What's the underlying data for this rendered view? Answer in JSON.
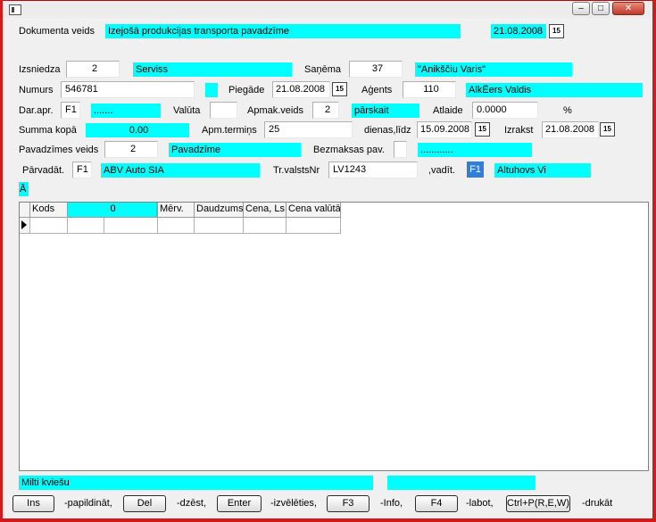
{
  "window": {
    "title": ""
  },
  "labels": {
    "doc_type": "Dokumenta veids",
    "issuer": "Izsniedza",
    "receiver": "Saņēma",
    "number": "Numurs",
    "delivery": "Piegāde",
    "agent": "Aģents",
    "dar_apr": "Dar.apr.",
    "currency": "Valūta",
    "payment_type": "Apmak.veids",
    "discount": "Atlaide",
    "percent": "%",
    "total": "Summa kopā",
    "payment_term": "Apm.termiņs",
    "days_until": "dienas,līdz",
    "issued": "Izrakst",
    "invoice_type": "Pavadzīmes veids",
    "free_inv": "Bezmaksas pav.",
    "seller": "Pārvadāt.",
    "vehicle": "Tr.valstsNr",
    "driver": ",vadīt."
  },
  "fields": {
    "doc_type_name": "Izejošā produkcijas transporta pavadzīme",
    "doc_date": "21.08.2008",
    "issuer_code": "2",
    "issuer_name": "Serviss",
    "receiver_code": "37",
    "receiver_name": "\"Anikščiu Varis\"",
    "number": "546781",
    "delivery_date": "21.08.2008",
    "agent_code": "110",
    "agent_name": "AlkĒers Valdis",
    "dar_apr_code": "F1",
    "dar_apr_name": ".......",
    "currency": "",
    "payment_type_code": "2",
    "payment_type_name": "pārskait",
    "discount": "0.0000",
    "total": "0.00",
    "payment_term": "25",
    "term_date": "15.09.2008",
    "issued_date": "21.08.2008",
    "invoice_type_code": "2",
    "invoice_type_name": "Pavadzīme",
    "free_inv_value": "",
    "free_inv_name": "............",
    "seller_code": "F1",
    "seller_name": "ABV Auto SIA",
    "vehicle_nr": "LV1243",
    "driver_code": "F1",
    "driver_name": "Altuhovs Vi",
    "a_marker": "Ā"
  },
  "grid": {
    "columns": [
      "Kods",
      "0",
      "",
      "Mērv.",
      "Daudzums",
      "Cena, Ls",
      "Cena valūtā"
    ]
  },
  "footer": {
    "item_desc": "Milti kviešu",
    "item_extra": ""
  },
  "buttons": [
    {
      "key": "Ins",
      "hint": "-papildināt,"
    },
    {
      "key": "Del",
      "hint": "-dzēst,"
    },
    {
      "key": "Enter",
      "hint": "-izvēlēties,"
    },
    {
      "key": "F3",
      "hint": "-Info,"
    },
    {
      "key": "F4",
      "hint": "-labot,"
    },
    {
      "key": "Ctrl+P(R,E,W)",
      "hint": "-drukāt"
    }
  ],
  "colors": {
    "highlight": "#00ffff",
    "frame": "#d11a1a"
  }
}
